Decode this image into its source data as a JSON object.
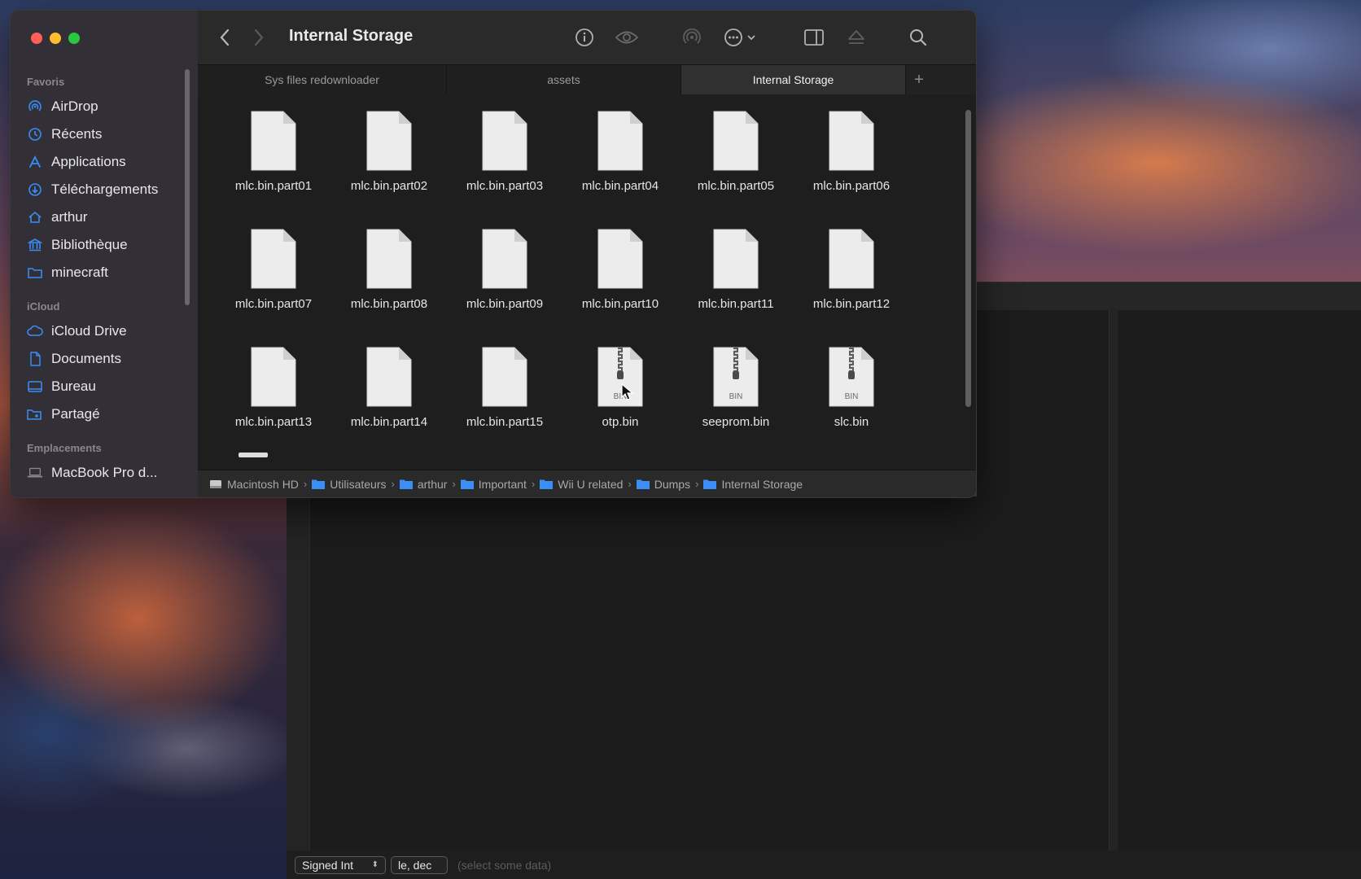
{
  "window": {
    "title": "Internal Storage"
  },
  "sidebar": {
    "sections": [
      {
        "title": "Favoris",
        "items": [
          {
            "label": "AirDrop",
            "icon": "airdrop-icon"
          },
          {
            "label": "Récents",
            "icon": "clock-icon"
          },
          {
            "label": "Applications",
            "icon": "applications-icon"
          },
          {
            "label": "Téléchargements",
            "icon": "download-icon"
          },
          {
            "label": "arthur",
            "icon": "home-icon"
          },
          {
            "label": "Bibliothèque",
            "icon": "library-icon"
          },
          {
            "label": "minecraft",
            "icon": "folder-icon"
          }
        ]
      },
      {
        "title": "iCloud",
        "items": [
          {
            "label": "iCloud Drive",
            "icon": "cloud-icon"
          },
          {
            "label": "Documents",
            "icon": "document-icon"
          },
          {
            "label": "Bureau",
            "icon": "desktop-icon"
          },
          {
            "label": "Partagé",
            "icon": "shared-folder-icon"
          }
        ]
      },
      {
        "title": "Emplacements",
        "items": [
          {
            "label": "MacBook Pro d...",
            "icon": "laptop-icon"
          }
        ]
      }
    ]
  },
  "toolbar": {
    "back": "chevron-left-icon",
    "forward": "chevron-right-icon",
    "info": "info-icon",
    "quicklook": "eye-icon",
    "airdrop": "airdrop-icon",
    "more": "ellipsis-circle-icon",
    "preview_pane": "sidebar-right-icon",
    "eject": "eject-icon",
    "search": "search-icon"
  },
  "tabs": [
    {
      "label": "Sys files redownloader",
      "active": false
    },
    {
      "label": "assets",
      "active": false
    },
    {
      "label": "Internal Storage",
      "active": true
    }
  ],
  "files": [
    {
      "name": "mlc.bin.part01",
      "kind": "doc"
    },
    {
      "name": "mlc.bin.part02",
      "kind": "doc"
    },
    {
      "name": "mlc.bin.part03",
      "kind": "doc"
    },
    {
      "name": "mlc.bin.part04",
      "kind": "doc"
    },
    {
      "name": "mlc.bin.part05",
      "kind": "doc"
    },
    {
      "name": "mlc.bin.part06",
      "kind": "doc"
    },
    {
      "name": "mlc.bin.part07",
      "kind": "doc"
    },
    {
      "name": "mlc.bin.part08",
      "kind": "doc"
    },
    {
      "name": "mlc.bin.part09",
      "kind": "doc"
    },
    {
      "name": "mlc.bin.part10",
      "kind": "doc"
    },
    {
      "name": "mlc.bin.part11",
      "kind": "doc"
    },
    {
      "name": "mlc.bin.part12",
      "kind": "doc"
    },
    {
      "name": "mlc.bin.part13",
      "kind": "doc"
    },
    {
      "name": "mlc.bin.part14",
      "kind": "doc"
    },
    {
      "name": "mlc.bin.part15",
      "kind": "doc"
    },
    {
      "name": "otp.bin",
      "kind": "bin",
      "badge": "BIN"
    },
    {
      "name": "seeprom.bin",
      "kind": "bin",
      "badge": "BIN"
    },
    {
      "name": "slc.bin",
      "kind": "bin",
      "badge": "BIN"
    }
  ],
  "path": [
    {
      "label": "Macintosh HD",
      "icon": "hard-drive-icon"
    },
    {
      "label": "Utilisateurs",
      "icon": "folder-icon"
    },
    {
      "label": "arthur",
      "icon": "folder-icon"
    },
    {
      "label": "Important",
      "icon": "folder-icon"
    },
    {
      "label": "Wii U related",
      "icon": "folder-icon"
    },
    {
      "label": "Dumps",
      "icon": "folder-icon"
    },
    {
      "label": "Internal Storage",
      "icon": "folder-icon"
    }
  ],
  "statusbar": {
    "type_select": "Signed Int",
    "endian_select": "le, dec",
    "hint": "(select some data)"
  },
  "colors": {
    "accent": "#3a8ef6",
    "traffic_red": "#ff5f57",
    "traffic_yellow": "#febc2e",
    "traffic_green": "#28c840"
  }
}
